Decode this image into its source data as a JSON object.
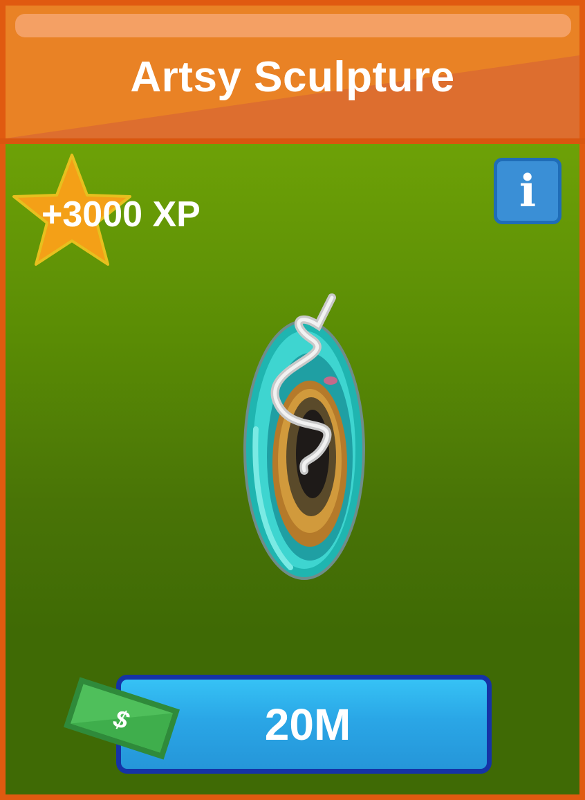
{
  "item": {
    "title": "Artsy Sculpture",
    "xp_reward": "+3000 XP",
    "price": "20M"
  },
  "info_button": {
    "glyph": "i",
    "icon": "info-icon"
  },
  "icons": {
    "star": "star-icon",
    "cash": "cash-icon",
    "item_image": "artsy-sculpture-image"
  },
  "colors": {
    "frame": "#d9560f",
    "header": "#e98225",
    "body_top": "#6da107",
    "body_bottom": "#3f6a05",
    "star": "#f4a017",
    "info": "#3a8fd6",
    "price_button": "#2aa6e6",
    "price_border": "#1533a6",
    "cash": "#3caa48"
  }
}
